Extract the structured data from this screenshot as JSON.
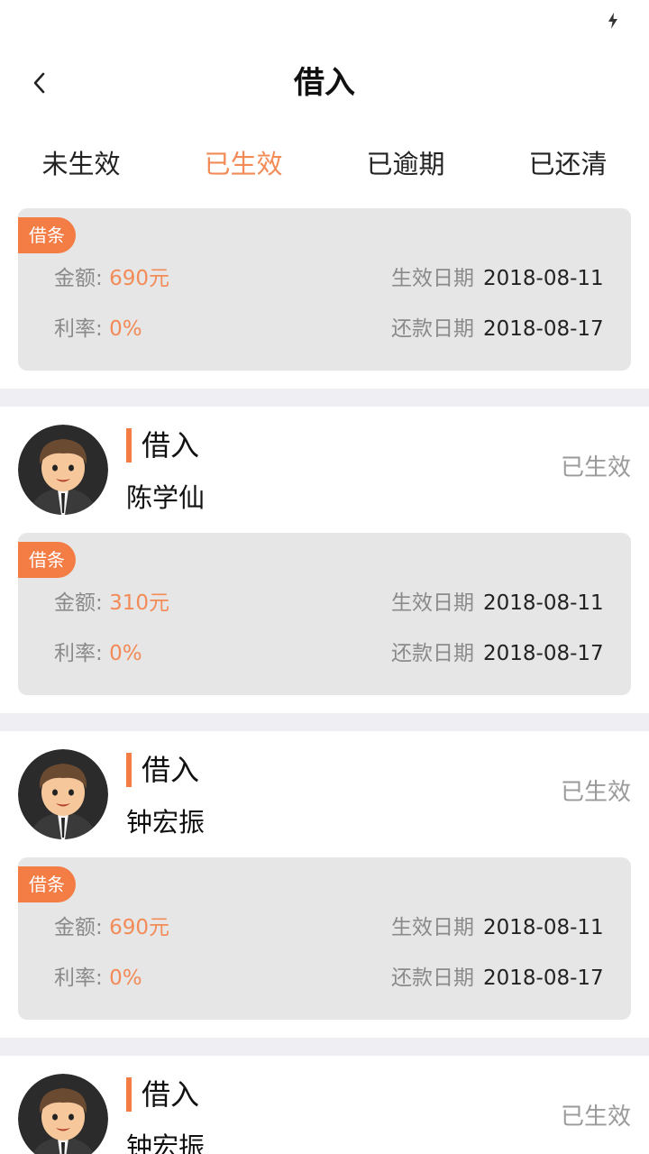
{
  "nav": {
    "title": "借入"
  },
  "tabs": [
    {
      "label": "未生效"
    },
    {
      "label": "已生效"
    },
    {
      "label": "已逾期"
    },
    {
      "label": "已还清"
    }
  ],
  "colors": {
    "accent": "#f28b57",
    "tag": "#f47c45",
    "card_bg": "#e6e6e6",
    "band": "#efeff3"
  },
  "card_labels": {
    "tag": "借条",
    "amount_label": "金额:",
    "rate_label": "利率:",
    "effective_label": "生效日期",
    "repay_label": "还款日期"
  },
  "items": [
    {
      "amount": "690元",
      "rate": "0%",
      "effective_date": "2018-08-11",
      "repay_date": "2018-08-17"
    },
    {
      "type": "借入",
      "name": "陈学仙",
      "status": "已生效",
      "amount": "310元",
      "rate": "0%",
      "effective_date": "2018-08-11",
      "repay_date": "2018-08-17"
    },
    {
      "type": "借入",
      "name": "钟宏振",
      "status": "已生效",
      "amount": "690元",
      "rate": "0%",
      "effective_date": "2018-08-11",
      "repay_date": "2018-08-17"
    },
    {
      "type": "借入",
      "name": "钟宏振",
      "status": "已生效"
    }
  ]
}
